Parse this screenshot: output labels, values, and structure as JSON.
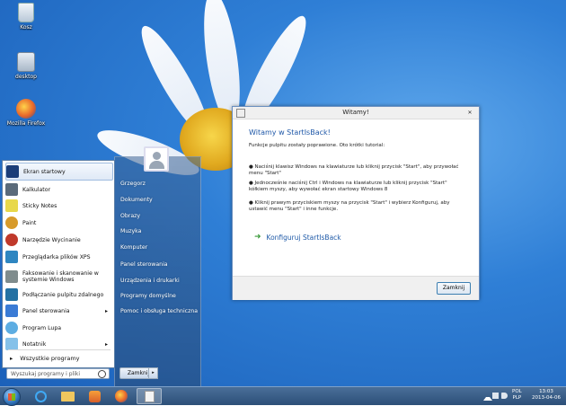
{
  "desktop": {
    "icons": [
      {
        "label": "Kosz",
        "icon": "recycle-bin-icon"
      },
      {
        "label": "desktop",
        "icon": "desktop-folder-icon"
      },
      {
        "label": "Mozilla Firefox",
        "icon": "firefox-icon"
      }
    ]
  },
  "start_menu": {
    "programs": [
      {
        "label": "Ekran startowy",
        "icon": "start-screen-icon",
        "color": "#1b3d78"
      },
      {
        "label": "Kalkulator",
        "icon": "calculator-icon",
        "color": "#5a6a7a"
      },
      {
        "label": "Sticky Notes",
        "icon": "sticky-notes-icon",
        "color": "#e8d84a"
      },
      {
        "label": "Paint",
        "icon": "paint-icon",
        "color": "#d79a2a"
      },
      {
        "label": "Narzędzie Wycinanie",
        "icon": "snipping-tool-icon",
        "color": "#c0392b"
      },
      {
        "label": "Przeglądarka plików XPS",
        "icon": "xps-viewer-icon",
        "color": "#2e86c1"
      },
      {
        "label": "Faksowanie i skanowanie w systemie Windows",
        "label_line1": "Faksowanie i skanowanie w",
        "label_line2": "systemie Windows",
        "icon": "fax-scan-icon",
        "color": "#7f8c8d"
      },
      {
        "label": "Podłączanie pulpitu zdalnego",
        "icon": "remote-desktop-icon",
        "color": "#2471a3"
      },
      {
        "label": "Panel sterowania",
        "icon": "control-panel-icon",
        "color": "#3a7bd5",
        "submenu": "▸"
      },
      {
        "label": "Program Lupa",
        "icon": "magnifier-icon",
        "color": "#5dade2"
      },
      {
        "label": "Notatnik",
        "icon": "notepad-icon",
        "color": "#85c1e9",
        "submenu": "▸"
      }
    ],
    "all_programs": "Wszystkie programy",
    "all_programs_arrow": "▸",
    "search_placeholder": "Wyszukaj programy i pliki",
    "right_pane": [
      "Grzegorz",
      "Dokumenty",
      "Obrazy",
      "Muzyka",
      "Komputer",
      "Panel sterowania",
      "Urządzenia i drukarki",
      "Programy domyślne",
      "Pomoc i obsługa techniczna"
    ],
    "shutdown_label": "Zamknij",
    "shutdown_arrow": "▸"
  },
  "dialog": {
    "title": "Witamy!",
    "close_glyph": "✕",
    "heading": "Witamy w StartIsBack!",
    "intro": "Funkcje pulpitu zostały poprawione. Oto krótki tutorial:",
    "tips": [
      "● Naciśnij klawisz Windows na klawiaturze lub kliknij przycisk \"Start\", aby przywołać menu \"Start\"",
      "● Jednocześnie naciśnij Ctrl i Windows na klawiaturze lub kliknij przycisk \"Start\" kółkiem myszy, aby wywołać ekran startowy Windows 8",
      "● Kliknij prawym przyciskiem myszy na przycisk \"Start\" i wybierz Konfiguruj, aby ustawić menu \"Start\" i inne funkcje."
    ],
    "link_arrow": "➜",
    "link_label": "Konfiguruj StartIsBack",
    "button_label": "Zamknij"
  },
  "taskbar": {
    "buttons": [
      {
        "icon": "internet-explorer-icon",
        "active": false
      },
      {
        "icon": "file-explorer-icon",
        "active": false
      },
      {
        "icon": "media-player-icon",
        "active": false
      },
      {
        "icon": "firefox-icon",
        "active": false
      },
      {
        "icon": "startisback-dialog-icon",
        "active": true
      }
    ],
    "language": "POL",
    "keyboard": "PLP",
    "time": "13:03",
    "date": "2013-04-06"
  }
}
